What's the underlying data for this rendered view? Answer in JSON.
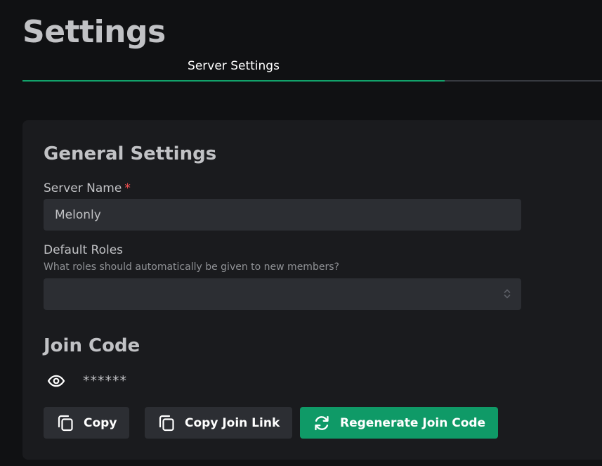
{
  "page": {
    "title": "Settings"
  },
  "tabs": [
    {
      "label": "Server Settings",
      "active": true
    }
  ],
  "general": {
    "title": "General Settings",
    "server_name": {
      "label": "Server Name",
      "required_mark": "*",
      "value": "Melonly"
    },
    "default_roles": {
      "label": "Default Roles",
      "description": "What roles should automatically be given to new members?",
      "value": ""
    }
  },
  "join_code": {
    "title": "Join Code",
    "masked_value": "******",
    "toggle_icon": "eye-icon",
    "buttons": {
      "copy": {
        "label": "Copy",
        "icon": "copy-icon"
      },
      "copy_link": {
        "label": "Copy Join Link",
        "icon": "copy-icon"
      },
      "regenerate": {
        "label": "Regenerate Join Code",
        "icon": "refresh-icon"
      }
    }
  },
  "colors": {
    "background": "#101113",
    "card": "#1a1b1e",
    "input": "#2c2e33",
    "accent": "#12a26a",
    "required": "#fa5252"
  }
}
